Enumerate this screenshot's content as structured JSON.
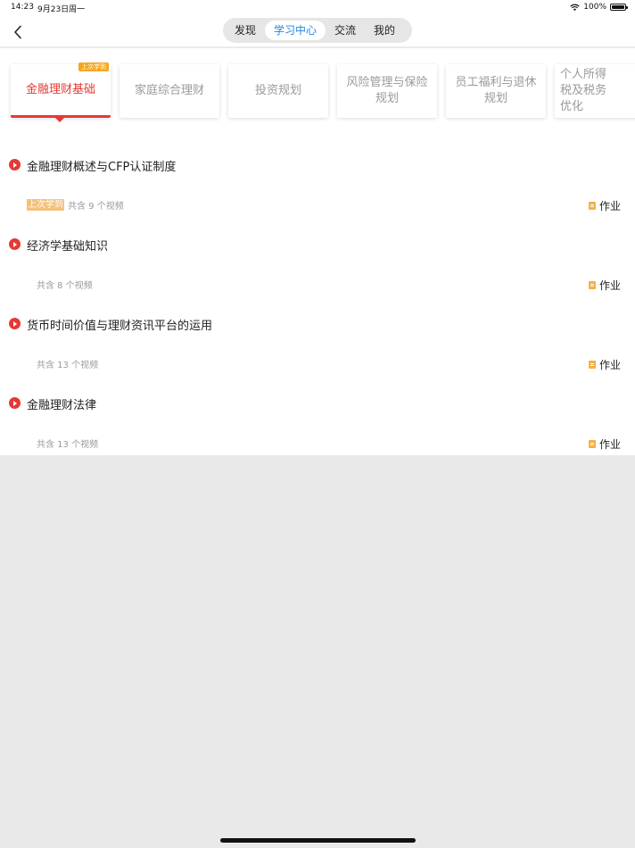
{
  "status": {
    "time": "14:23",
    "date": "9月23日周一",
    "battery": "100%",
    "battery_level": 1.0
  },
  "nav": {
    "tabs": [
      {
        "label": "发现",
        "active": false
      },
      {
        "label": "学习中心",
        "active": true
      },
      {
        "label": "交流",
        "active": false
      },
      {
        "label": "我的",
        "active": false
      }
    ]
  },
  "categories": [
    {
      "label": "金融理财基础",
      "active": true,
      "badge": "上次学到"
    },
    {
      "label": "家庭综合理财",
      "active": false
    },
    {
      "label": "投资规划",
      "active": false
    },
    {
      "label": "风险管理与保险规划",
      "active": false
    },
    {
      "label": "员工福利与退休规划",
      "active": false
    },
    {
      "label": "个人所得税及税务优化",
      "active": false
    }
  ],
  "lessons": [
    {
      "title": "金融理财概述与CFP认证制度",
      "last_tag": "上次学到",
      "count": "共含 9 个视频",
      "homework": "作业"
    },
    {
      "title": "经济学基础知识",
      "count": "共含 8 个视频",
      "homework": "作业"
    },
    {
      "title": "货币时间价值与理财资讯平台的运用",
      "count": "共含 13 个视频",
      "homework": "作业"
    },
    {
      "title": "金融理财法律",
      "count": "共含 13 个视频",
      "homework": "作业"
    }
  ],
  "colors": {
    "accent": "#e53935",
    "tab_active": "#1e88e5",
    "badge": "#f5a623"
  }
}
